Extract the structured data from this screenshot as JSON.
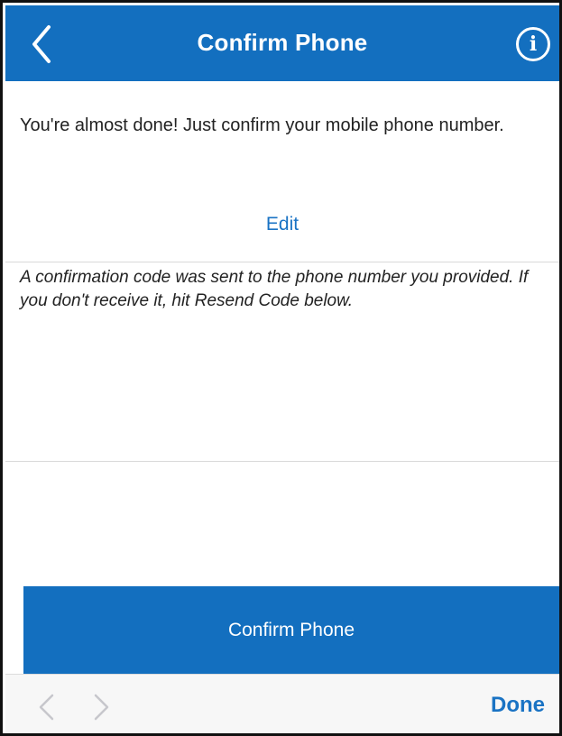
{
  "navbar": {
    "title": "Confirm Phone",
    "back_icon": "chevron-left-icon",
    "info_icon": "info-icon",
    "info_glyph": "i",
    "color": "#136fbf"
  },
  "intro": {
    "text": "You're almost done! Just confirm your mobile phone number.",
    "edit_label": "Edit"
  },
  "code_info": {
    "text": "A confirmation code was sent to the phone number you provided. If you don't receive it, hit Resend Code below."
  },
  "confirm_button": {
    "label": "Confirm Phone",
    "color": "#136fbf"
  },
  "toolbar": {
    "prev_icon": "chevron-left-icon",
    "next_icon": "chevron-right-icon",
    "done_label": "Done",
    "link_color": "#1a73c4"
  }
}
